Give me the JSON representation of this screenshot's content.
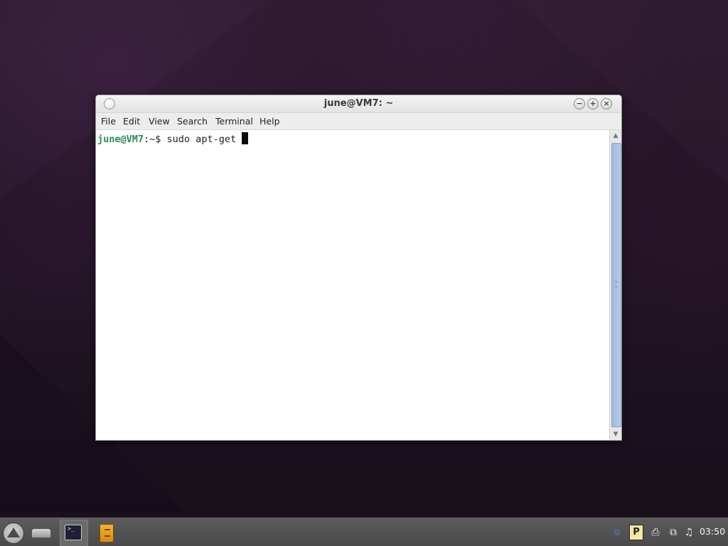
{
  "window": {
    "title": "june@VM7: ~"
  },
  "menubar": {
    "items": [
      "File",
      "Edit",
      "View",
      "Search",
      "Terminal",
      "Help"
    ]
  },
  "terminal": {
    "prompt_user": "june@VM7",
    "prompt_sep": ":~$ ",
    "command": "sudo apt-get "
  },
  "taskbar": {
    "tray_p_label": "P",
    "clock": "03:50"
  },
  "icons": {
    "launcher": "launcher-icon",
    "drive": "drive-icon",
    "terminal": "terminal-icon",
    "files": "file-manager-icon",
    "printer": "printer-icon",
    "network": "network-icon",
    "volume": "volume-icon"
  },
  "colors": {
    "prompt_user": "#2e8b57",
    "scrollbar_thumb": "#9fb8dd",
    "taskbar": "#4f4f4f"
  }
}
